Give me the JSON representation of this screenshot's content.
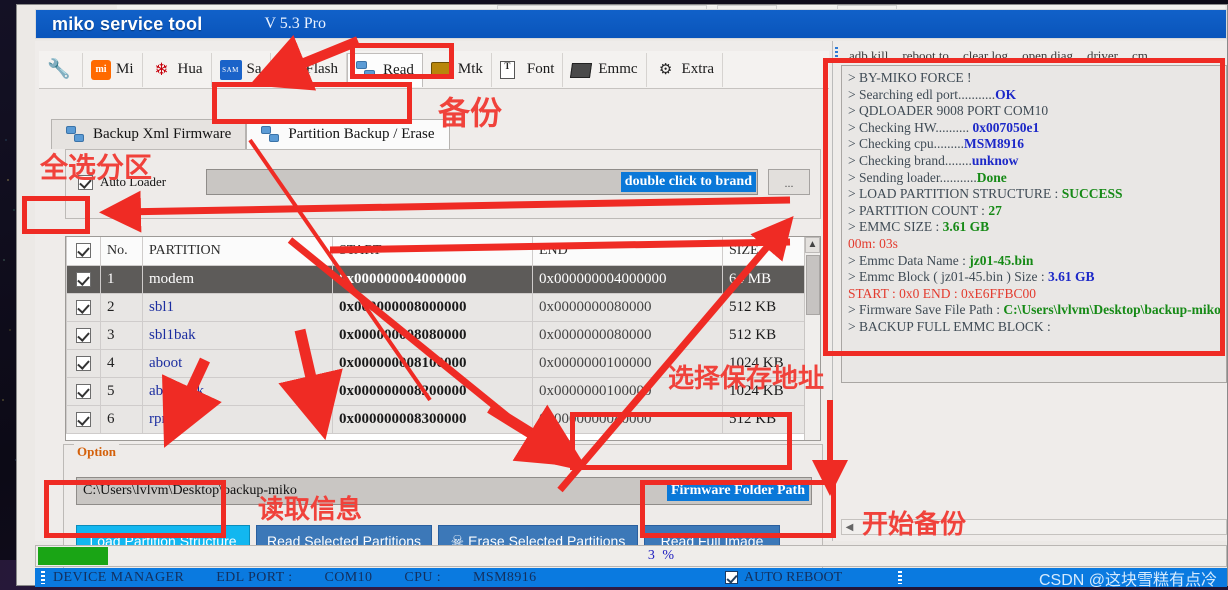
{
  "window": {
    "title": "miko service tool",
    "version": "V 5.3 Pro"
  },
  "module_tabs": [
    {
      "label": "",
      "icon": "wrench-icon",
      "active": false
    },
    {
      "label": "Mi",
      "icon": "xiaomi-icon",
      "active": false
    },
    {
      "label": "Hua",
      "icon": "huawei-icon",
      "active": false
    },
    {
      "label": "Sa",
      "icon": "samsung-icon",
      "active": false
    },
    {
      "label": "Flash",
      "icon": "lightning-icon",
      "active": false
    },
    {
      "label": "Read",
      "icon": "read-icon",
      "active": true
    },
    {
      "label": "Mtk",
      "icon": "mtk-icon",
      "active": false
    },
    {
      "label": "Font",
      "icon": "font-icon",
      "active": false
    },
    {
      "label": "Emmc",
      "icon": "emmc-icon",
      "active": false
    },
    {
      "label": "Extra",
      "icon": "extra-icon",
      "active": false
    }
  ],
  "sub_tabs": [
    {
      "label": "Backup Xml Firmware",
      "active": false
    },
    {
      "label": "Partition Backup / Erase",
      "active": true
    }
  ],
  "loader": {
    "checkbox_label": "Auto Loader",
    "checkbox_checked": true,
    "brand_field_value": "",
    "brand_field_hint": "double click to brand",
    "browse_button_label": "..."
  },
  "table": {
    "select_all_checked": true,
    "headers": [
      "",
      "No.",
      "PARTITION",
      "START",
      "END",
      "SIZE"
    ],
    "rows": [
      {
        "checked": true,
        "no": "1",
        "partition": "modem",
        "start": "0x000000004000000",
        "end": "0x000000004000000",
        "size": "64 MB",
        "selected": true
      },
      {
        "checked": true,
        "no": "2",
        "partition": "sbl1",
        "start": "0x000000008000000",
        "end": "0x0000000080000",
        "size": "512 KB",
        "selected": false
      },
      {
        "checked": true,
        "no": "3",
        "partition": "sbl1bak",
        "start": "0x000000008080000",
        "end": "0x0000000080000",
        "size": "512 KB",
        "selected": false
      },
      {
        "checked": true,
        "no": "4",
        "partition": "aboot",
        "start": "0x000000008100000",
        "end": "0x0000000100000",
        "size": "1024 KB",
        "selected": false
      },
      {
        "checked": true,
        "no": "5",
        "partition": "abootbak",
        "start": "0x000000008200000",
        "end": "0x0000000100000",
        "size": "1024 KB",
        "selected": false
      },
      {
        "checked": true,
        "no": "6",
        "partition": "rpm",
        "start": "0x000000008300000",
        "end": "0x0000000080000",
        "size": "512 KB",
        "selected": false
      }
    ]
  },
  "option": {
    "legend": "Option",
    "path_value": "C:\\Users\\lvlvm\\Desktop\\backup-miko",
    "path_tag": "Firmware Folder Path",
    "buttons": [
      {
        "label": "Load Partition Structure",
        "style": "cyan"
      },
      {
        "label": "Read Selected Partitions",
        "style": "blue"
      },
      {
        "label": "Erase Selected Partitions",
        "style": "blue",
        "icon": "skull-icon"
      },
      {
        "label": "Read Full Image",
        "style": "blue"
      }
    ]
  },
  "right_toolbar": [
    "adb kill",
    "reboot to",
    "clear log",
    "open diag",
    "driver",
    "cm"
  ],
  "log_lines": [
    {
      "text": "> BY-MIKO FORCE !",
      "value": "",
      "value_color": ""
    },
    {
      "text": "> Searching edl port...........",
      "value": "OK",
      "value_color": "blue"
    },
    {
      "text": "> QDLOADER 9008 PORT COM10",
      "value": "",
      "value_color": ""
    },
    {
      "text": "> Checking HW.......... ",
      "value": "0x007050e1",
      "value_color": "blue"
    },
    {
      "text": "> Checking cpu.........",
      "value": "MSM8916",
      "value_color": "blue"
    },
    {
      "text": "> Checking brand........",
      "value": "unknow",
      "value_color": "blue"
    },
    {
      "text": "> Sending loader...........",
      "value": "Done",
      "value_color": "green"
    },
    {
      "text": "> LOAD PARTITION  STRUCTURE  :  ",
      "value": "SUCCESS",
      "value_color": "green"
    },
    {
      "text": "> PARTITION COUNT  :  ",
      "value": "27",
      "value_color": "green"
    },
    {
      "text": "> EMMC SIZE  :  ",
      "value": "3.61 GB",
      "value_color": "green"
    },
    {
      "text": "00m: 03s",
      "value": "",
      "value_color": "",
      "whole_red": true
    },
    {
      "text": "> Emmc Data Name  :  ",
      "value": "jz01-45.bin",
      "value_color": "green"
    },
    {
      "text": "> Emmc Block ( jz01-45.bin ) Size   :   ",
      "value": "3.61 GB",
      "value_color": "blue"
    },
    {
      "text": " START  :   0x0     END :    0xE6FFBC00",
      "value": "",
      "value_color": "",
      "whole_red": true
    },
    {
      "text": "> Firmware Save File  Path : ",
      "value": "C:\\Users\\lvlvm\\Desktop\\backup-miko",
      "value_color": "green"
    },
    {
      "text": "> BACKUP FULL EMMC BLOCK   :",
      "value": "",
      "value_color": ""
    }
  ],
  "progress": {
    "percent_label": "3  %",
    "fill_percent": 6
  },
  "status_bar": {
    "device_manager": "DEVICE MANAGER",
    "edl_port_label": "EDL PORT  :",
    "edl_port_value": "COM10",
    "cpu_label": "CPU  :",
    "cpu_value": "MSM8916",
    "auto_reboot": "AUTO REBOOT",
    "watermark": "CSDN @这块雪糕有点冷"
  },
  "annotations": [
    {
      "id": "ann-backup",
      "text": "备份"
    },
    {
      "id": "ann-select-all",
      "text": "全选分区"
    },
    {
      "id": "ann-save-path",
      "text": "选择保存地址"
    },
    {
      "id": "ann-read-info",
      "text": "读取信息"
    },
    {
      "id": "ann-start-backup",
      "text": "开始备份"
    }
  ],
  "colors": {
    "accent": "#ef2b24",
    "titlebar": "#0a55bb",
    "button_blue": "#3c78b8",
    "button_cyan": "#12b7f0",
    "progress_green": "#1aa515"
  }
}
